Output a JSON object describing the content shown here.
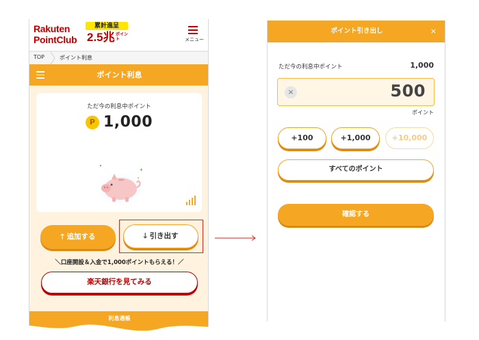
{
  "left_screen": {
    "logo": {
      "line1": "Rakuten",
      "line2": "PointClub"
    },
    "campaign": {
      "label": "累計進呈",
      "amount": "2.5兆",
      "unit": "ポイント"
    },
    "menu": {
      "label": "メニュー"
    },
    "breadcrumb": {
      "top": "TOP",
      "current": "ポイント利息"
    },
    "title": "ポイント利息",
    "points_card": {
      "label": "ただ今の利息中ポイント",
      "coin_symbol": "P",
      "value": "1,000"
    },
    "buttons": {
      "add": "追加する",
      "withdraw": "引き出す",
      "bank": "楽天銀行を見てみる"
    },
    "promo": "＼口座開設＆入金で1,000ポイントもらえる！／",
    "bottom_strip_label": "利息通帳"
  },
  "right_screen": {
    "title": "ポイント引き出し",
    "close_symbol": "×",
    "current_label": "ただ今の利息中ポイント",
    "current_value": "1,000",
    "amount": "500",
    "clear_symbol": "×",
    "unit": "ポイント",
    "increments": [
      {
        "label": "+100",
        "enabled": true
      },
      {
        "label": "+1,000",
        "enabled": true
      },
      {
        "label": "+10,000",
        "enabled": false
      }
    ],
    "all_points_label": "すべてのポイント",
    "confirm_label": "確認する"
  },
  "colors": {
    "brand_red": "#bf0000",
    "accent_orange": "#f5a623",
    "highlight_frame": "#d9261c",
    "body_bg": "#fff2de"
  },
  "icons": [
    "hamburger-menu-icon",
    "breadcrumb-chevron-icon",
    "point-coin-icon",
    "piggy-bank-icon",
    "bar-chart-icon",
    "arrow-up-icon",
    "arrow-down-icon",
    "close-icon",
    "clear-icon",
    "flow-arrow-icon"
  ]
}
